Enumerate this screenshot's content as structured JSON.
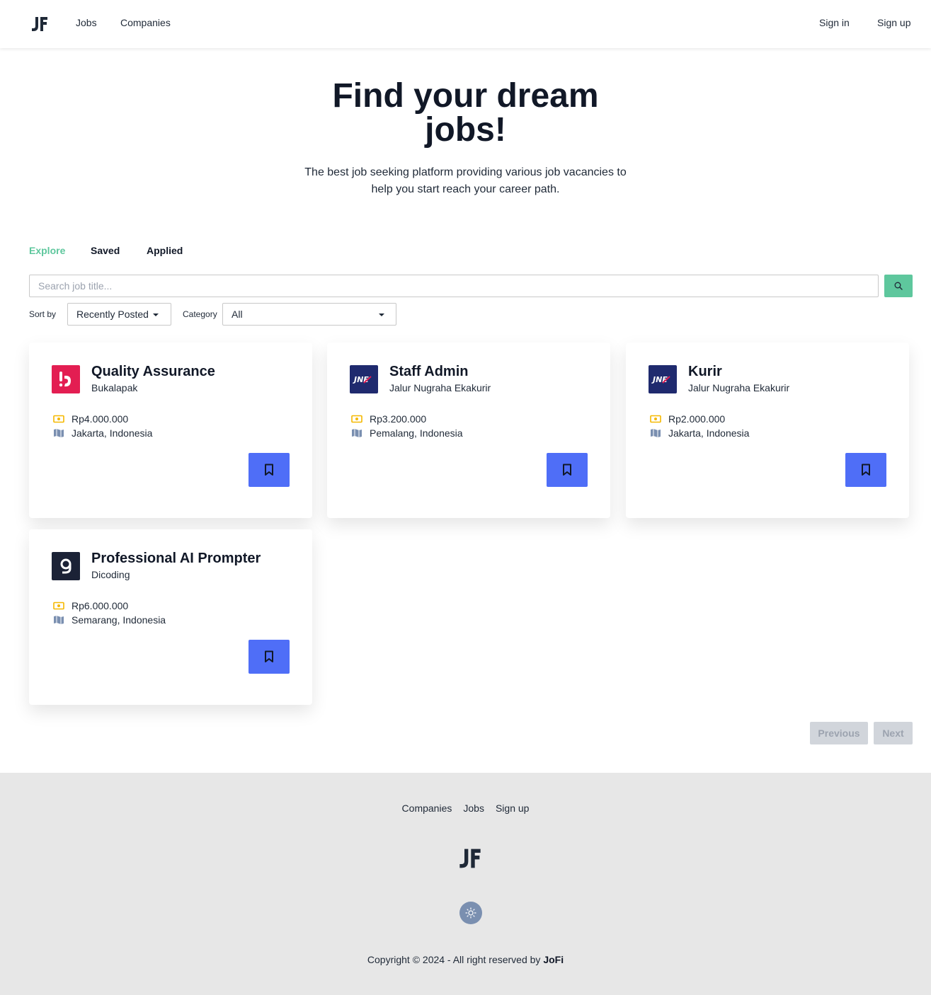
{
  "navbar": {
    "logo_text": "JF",
    "links": [
      "Jobs",
      "Companies"
    ],
    "sign_in": "Sign in",
    "sign_up": "Sign up"
  },
  "hero": {
    "title": "Find your dream jobs!",
    "subtitle": "The best job seeking platform providing various job vacancies to help you start reach your career path."
  },
  "tabs": {
    "explore": "Explore",
    "saved": "Saved",
    "applied": "Applied",
    "active": "Explore"
  },
  "search": {
    "placeholder": "Search job title...",
    "value": ""
  },
  "filters": {
    "sort_label": "Sort by",
    "sort_value": "Recently Posted",
    "category_label": "Category",
    "category_value": "All"
  },
  "jobs": [
    {
      "title": "Quality Assurance",
      "company": "Bukalapak",
      "salary": "Rp4.000.000",
      "location": "Jakarta, Indonesia",
      "logo": "bukalapak-logo"
    },
    {
      "title": "Staff Admin",
      "company": "Jalur Nugraha Ekakurir",
      "salary": "Rp3.200.000",
      "location": "Pemalang, Indonesia",
      "logo": "jne-logo"
    },
    {
      "title": "Kurir",
      "company": "Jalur Nugraha Ekakurir",
      "salary": "Rp2.000.000",
      "location": "Jakarta, Indonesia",
      "logo": "jne-logo"
    },
    {
      "title": "Professional AI Prompter",
      "company": "Dicoding",
      "salary": "Rp6.000.000",
      "location": "Semarang, Indonesia",
      "logo": "dicoding-logo"
    }
  ],
  "pagination": {
    "previous": "Previous",
    "next": "Next"
  },
  "footer": {
    "links": [
      "Companies",
      "Jobs",
      "Sign up"
    ],
    "logo_text": "JF",
    "copyright_prefix": "Copyright © 2024 - All right reserved by",
    "brand": "JoFi"
  },
  "colors": {
    "accent": "#5ec79d",
    "primary_button": "#4f6ef7",
    "salary_icon": "#f5b800",
    "location_icon": "#7a8fb0",
    "footer_bg": "#e7e7e7",
    "bukalapak": "#e31e52",
    "jne": "#1f2a6e",
    "dicoding": "#1b2236"
  }
}
